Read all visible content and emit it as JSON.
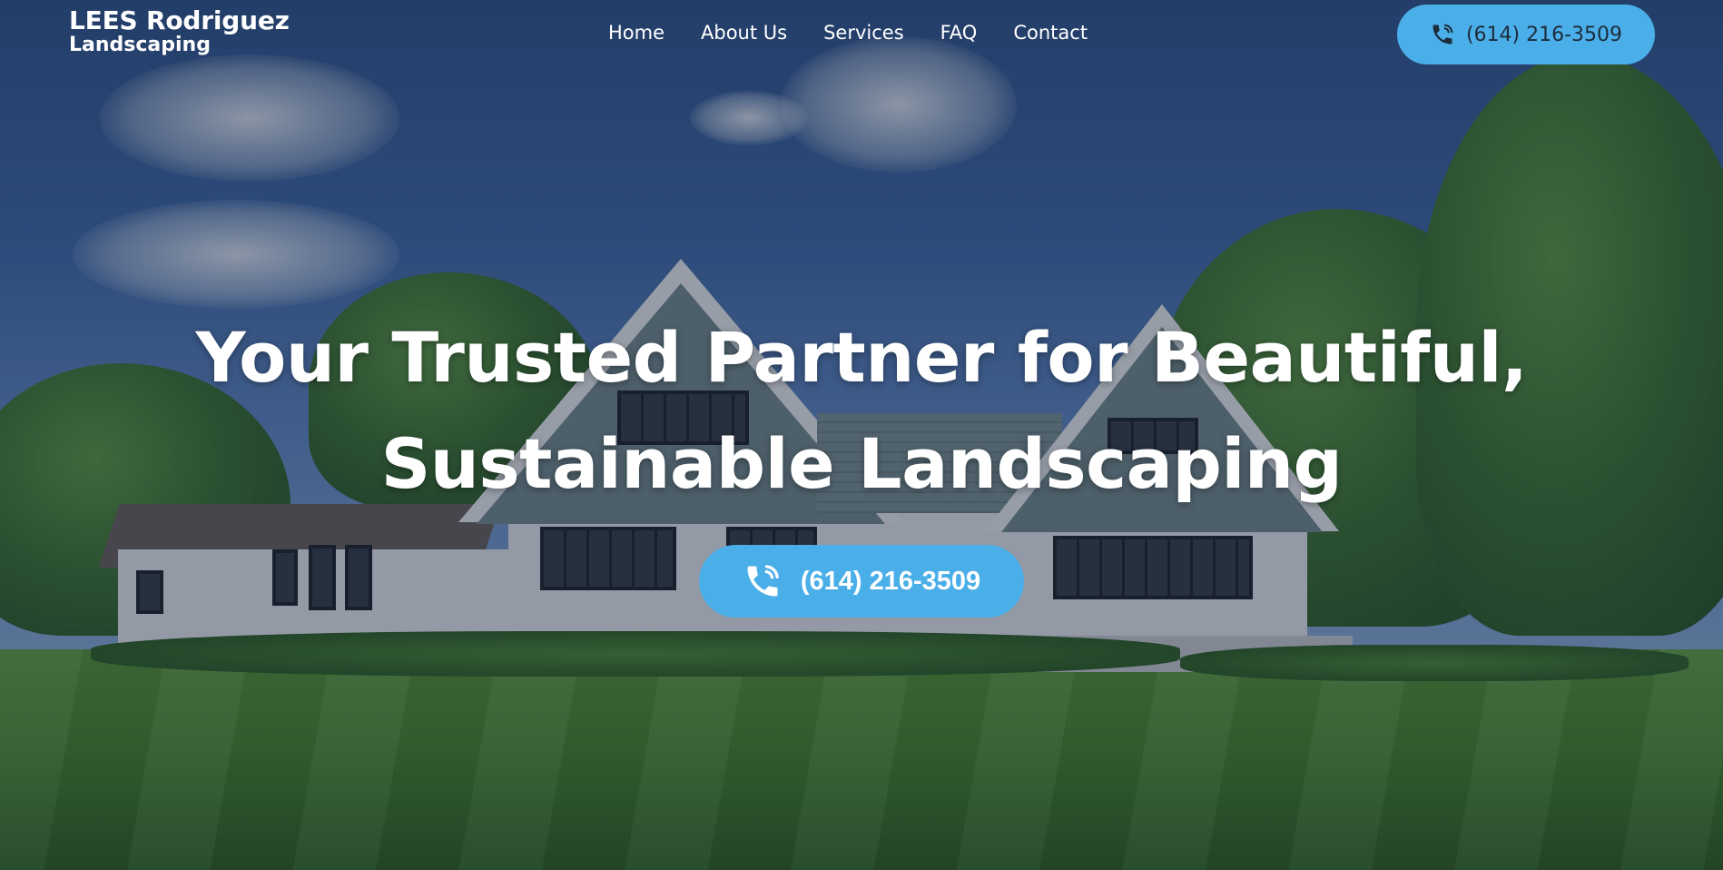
{
  "brand": {
    "name_line1": "LEES Rodriguez",
    "name_line2": "Landscaping"
  },
  "nav": {
    "items": [
      {
        "label": "Home"
      },
      {
        "label": "About Us"
      },
      {
        "label": "Services"
      },
      {
        "label": "FAQ"
      },
      {
        "label": "Contact"
      }
    ]
  },
  "header_cta": {
    "phone": "(614) 216-3509",
    "icon": "phone-icon"
  },
  "hero": {
    "headline_line1": "Your Trusted Partner for Beautiful,",
    "headline_line2": "Sustainable Landscaping",
    "cta_phone": "(614) 216-3509",
    "cta_icon": "phone-icon"
  },
  "colors": {
    "accent": "#4aaee8",
    "text_light": "#ffffff",
    "text_dark": "#1d2c3b"
  }
}
